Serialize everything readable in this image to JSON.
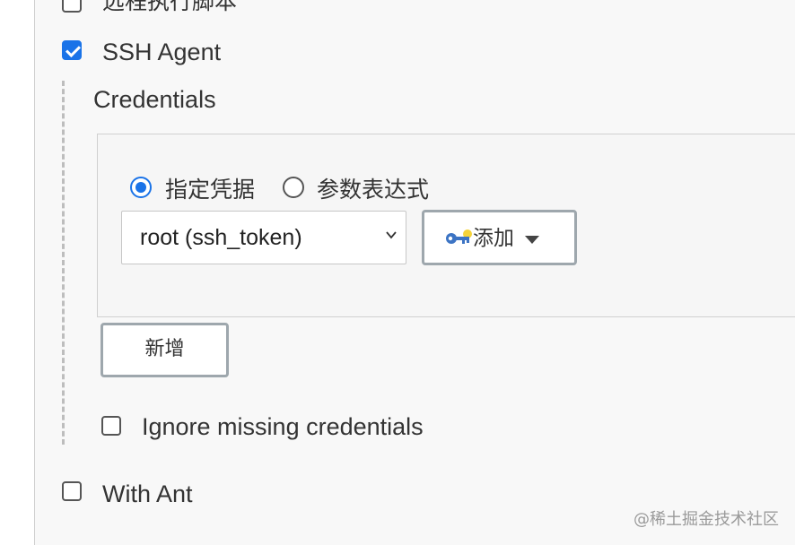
{
  "top_option": {
    "label": "远程执行脚本",
    "checked": false
  },
  "ssh_agent": {
    "label": "SSH Agent",
    "checked": true,
    "credentials_title": "Credentials",
    "mode_options": [
      {
        "label": "指定凭据",
        "selected": true
      },
      {
        "label": "参数表达式",
        "selected": false
      }
    ],
    "credential_select": {
      "value": "root (ssh_token)"
    },
    "add_button": {
      "label": "添加",
      "icon": "key-icon"
    },
    "new_button": {
      "label": "新增"
    },
    "ignore_missing": {
      "label": "Ignore missing credentials",
      "checked": false
    }
  },
  "with_ant": {
    "label": "With Ant",
    "checked": false
  },
  "watermark": "@稀土掘金技术社区",
  "colors": {
    "accent": "#1a73e8",
    "text": "#333333",
    "panel_border": "#d0d0d0"
  }
}
